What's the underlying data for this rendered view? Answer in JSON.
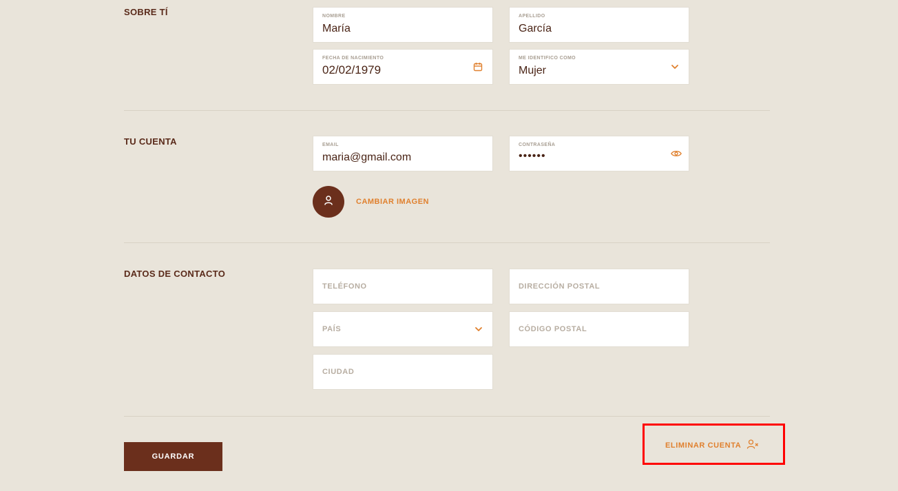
{
  "sections": {
    "about": {
      "title": "SOBRE TÍ",
      "first_name": {
        "label": "NOMBRE",
        "value": "María"
      },
      "last_name": {
        "label": "APELLIDO",
        "value": "García"
      },
      "birthdate": {
        "label": "FECHA DE NACIMIENTO",
        "value": "02/02/1979",
        "icon": "calendar-icon"
      },
      "gender": {
        "label": "ME IDENTIFICO COMO",
        "value": "Mujer",
        "icon": "chevron-down-icon"
      }
    },
    "account": {
      "title": "TU CUENTA",
      "email": {
        "label": "EMAIL",
        "value": "maria@gmail.com"
      },
      "password": {
        "label": "CONTRASEÑA",
        "value": "••••••",
        "icon": "eye-icon"
      },
      "avatar_icon": "user-icon",
      "change_image": "CAMBIAR IMAGEN"
    },
    "contact": {
      "title": "DATOS DE CONTACTO",
      "phone": {
        "placeholder": "TELÉFONO"
      },
      "address": {
        "placeholder": "DIRECCIÓN POSTAL"
      },
      "country": {
        "placeholder": "PAÍS",
        "icon": "chevron-down-icon"
      },
      "postal_code": {
        "placeholder": "CÓDIGO POSTAL"
      },
      "city": {
        "placeholder": "CIUDAD"
      }
    }
  },
  "actions": {
    "save": "GUARDAR",
    "delete_account": "ELIMINAR CUENTA",
    "delete_icon": "user-remove-icon"
  },
  "colors": {
    "background": "#e9e4da",
    "brand_dark": "#6b2f1c",
    "accent": "#e0802e",
    "highlight": "#ff0000"
  }
}
